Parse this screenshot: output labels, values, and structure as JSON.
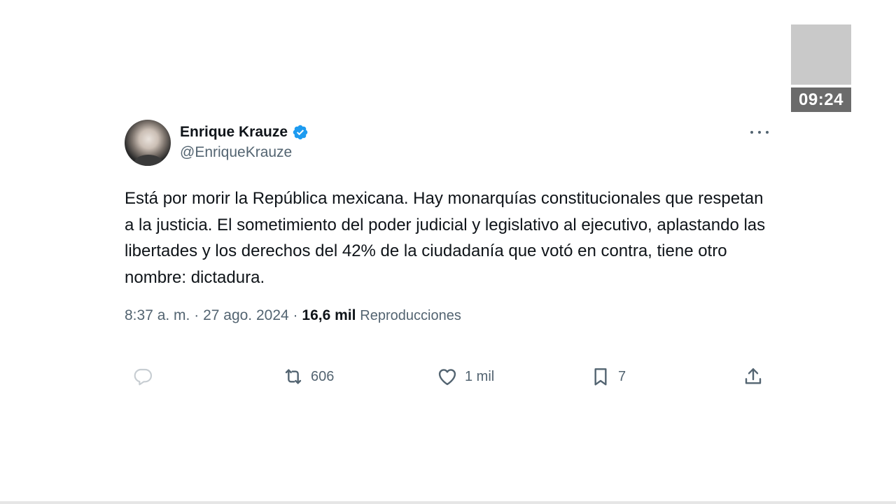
{
  "overlay": {
    "clock": "09:24"
  },
  "tweet": {
    "author": {
      "display_name": "Enrique Krauze",
      "handle": "@EnriqueKrauze",
      "verified": true,
      "verified_color": "#1d9bf0"
    },
    "text": "Está por morir la República mexicana. Hay monarquías constitucionales que respetan a la justicia. El sometimiento del poder judicial y legislativo al ejecutivo, aplastando las libertades y los derechos del 42% de la ciudadanía que votó en contra, tiene otro nombre: dictadura.",
    "time": "8:37 a. m.",
    "separator": "·",
    "date": "27 ago. 2024",
    "views_count": "16,6 mil",
    "views_label": "Reproducciones",
    "actions": {
      "reply": {
        "icon": "reply-icon",
        "count": ""
      },
      "repost": {
        "icon": "repost-icon",
        "count": "606"
      },
      "like": {
        "icon": "heart-icon",
        "count": "1 mil"
      },
      "bookmark": {
        "icon": "bookmark-icon",
        "count": "7"
      },
      "share": {
        "icon": "share-icon",
        "count": ""
      }
    }
  },
  "colors": {
    "text_primary": "#0f1419",
    "text_secondary": "#536471",
    "reply_icon": "#c7cdd2"
  }
}
